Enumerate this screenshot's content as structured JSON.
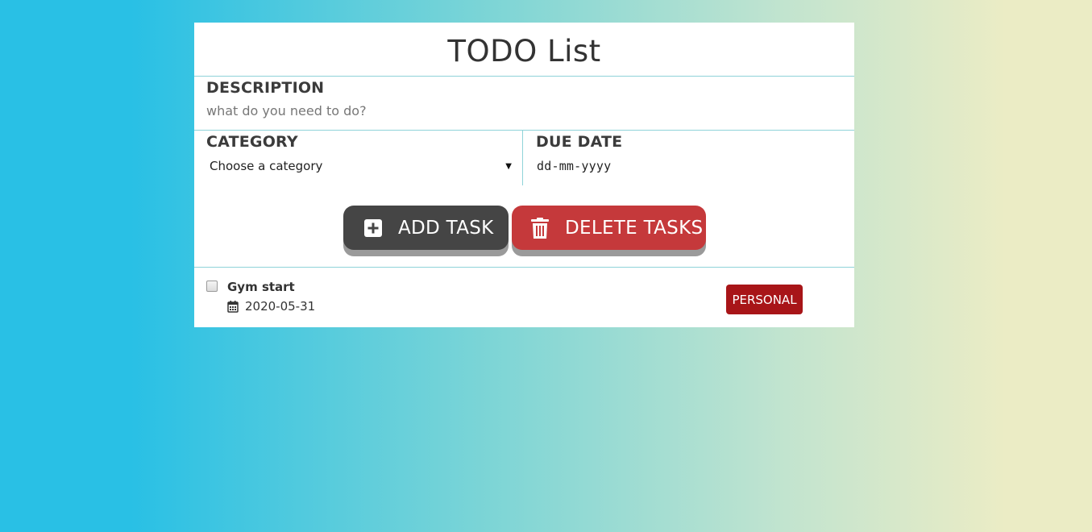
{
  "app": {
    "title": "TODO List"
  },
  "form": {
    "description_label": "DESCRIPTION",
    "description_placeholder": "what do you need to do?",
    "description_value": "",
    "category_label": "CATEGORY",
    "category_selected": "Choose a category",
    "due_date_label": "DUE DATE",
    "due_date_placeholder": "dd-mm-yyyy"
  },
  "buttons": {
    "add_label": "ADD TASK",
    "add_icon": "plus-square-icon",
    "delete_label": "DELETE TASKS",
    "delete_icon": "trash-icon"
  },
  "tasks": [
    {
      "title": "Gym start",
      "date": "2020-05-31",
      "date_icon": "calendar-icon",
      "category": "PERSONAL",
      "checked": false
    }
  ],
  "colors": {
    "add_button": "#454545",
    "delete_button": "#c5393b",
    "personal_tag": "#a81518",
    "divider": "#8fd3d9"
  }
}
